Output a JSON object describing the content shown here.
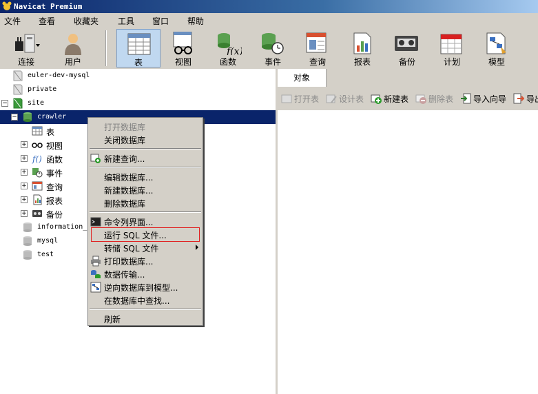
{
  "window": {
    "title": "Navicat Premium"
  },
  "menu": [
    "文件",
    "查看",
    "收藏夹",
    "工具",
    "窗口",
    "帮助"
  ],
  "toolbar": [
    {
      "label": "连接",
      "icon": "plug-icon"
    },
    {
      "label": "用户",
      "icon": "user-icon"
    },
    {
      "label": "表",
      "icon": "table-icon",
      "active": true
    },
    {
      "label": "视图",
      "icon": "glasses-icon"
    },
    {
      "label": "函数",
      "icon": "function-icon"
    },
    {
      "label": "事件",
      "icon": "event-icon"
    },
    {
      "label": "查询",
      "icon": "query-icon"
    },
    {
      "label": "报表",
      "icon": "report-icon"
    },
    {
      "label": "备份",
      "icon": "backup-icon"
    },
    {
      "label": "计划",
      "icon": "calendar-icon"
    },
    {
      "label": "模型",
      "icon": "model-icon"
    }
  ],
  "tree": {
    "connections": [
      "euler-dev-mysql",
      "private",
      "site"
    ],
    "database": "crawler",
    "children": [
      "表",
      "视图",
      "函数",
      "事件",
      "查询",
      "报表",
      "备份"
    ],
    "other_databases": [
      "information_",
      "mysql",
      "test"
    ]
  },
  "right": {
    "tab": "对象",
    "buttons": [
      "打开表",
      "设计表",
      "新建表",
      "删除表",
      "导入向导",
      "导出"
    ]
  },
  "context_menu": [
    "打开数据库",
    "关闭数据库",
    "新建查询...",
    "编辑数据库...",
    "新建数据库...",
    "删除数据库",
    "命令列界面...",
    "运行 SQL 文件...",
    "转储 SQL 文件",
    "打印数据库...",
    "数据传输...",
    "逆向数据库到模型...",
    "在数据库中查找...",
    "刷新"
  ],
  "colors": {
    "selection": "#0a246a",
    "highlight_border": "#e02020",
    "chrome": "#d4d0c8"
  }
}
